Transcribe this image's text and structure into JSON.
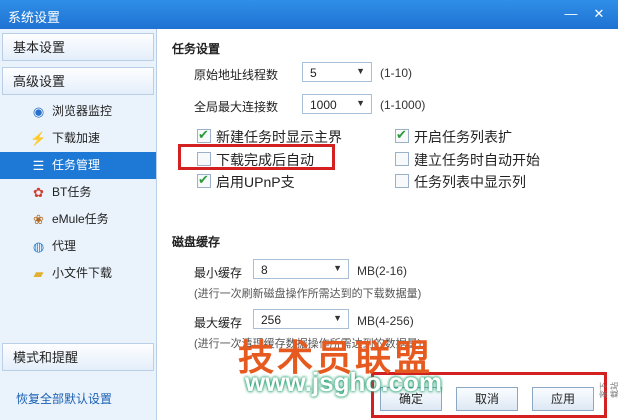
{
  "window": {
    "title": "系统设置"
  },
  "sidebar": {
    "basic_header": "基本设置",
    "advanced_header": "高级设置",
    "items": [
      {
        "label": "浏览器监控",
        "icon": "browser-monitor-icon"
      },
      {
        "label": "下载加速",
        "icon": "lightning-icon"
      },
      {
        "label": "任务管理",
        "icon": "task-list-icon",
        "active": true
      },
      {
        "label": "BT任务",
        "icon": "bt-icon"
      },
      {
        "label": "eMule任务",
        "icon": "emule-icon"
      },
      {
        "label": "代理",
        "icon": "proxy-icon"
      },
      {
        "label": "小文件下载",
        "icon": "folder-icon"
      }
    ],
    "mode_header": "模式和提醒",
    "restore_link": "恢复全部默认设置"
  },
  "task_settings": {
    "title": "任务设置",
    "thread_label": "原始地址线程数",
    "thread_value": "5",
    "thread_range": "(1-10)",
    "conn_label": "全局最大连接数",
    "conn_value": "1000",
    "conn_range": "(1-1000)",
    "checkboxes": [
      {
        "label": "新建任务时显示主界",
        "checked": true
      },
      {
        "label": "开启任务列表扩",
        "checked": true
      },
      {
        "label": "下载完成后自动",
        "checked": false
      },
      {
        "label": "建立任务时自动开始",
        "checked": false
      },
      {
        "label": "启用UPnP支",
        "checked": true
      },
      {
        "label": "任务列表中显示列",
        "checked": false
      }
    ]
  },
  "disk_cache": {
    "title": "磁盘缓存",
    "min_label": "最小缓存",
    "min_value": "8",
    "min_range": "MB(2-16)",
    "min_hint": "(进行一次刷新磁盘操作所需达到的下载数据量)",
    "max_label": "最大缓存",
    "max_value": "256",
    "max_range": "MB(4-256)",
    "max_hint": "(进行一次清理缓存数据操作所需达到的数据量)"
  },
  "buttons": {
    "ok": "确定",
    "cancel": "取消",
    "apply": "应用"
  },
  "watermark": {
    "main": "技术员联盟",
    "url": "www.jsgho.com",
    "side": "家下载站"
  },
  "colors": {
    "accent": "#1e78d6",
    "highlight": "#d32020",
    "check": "#2a9a3a"
  }
}
